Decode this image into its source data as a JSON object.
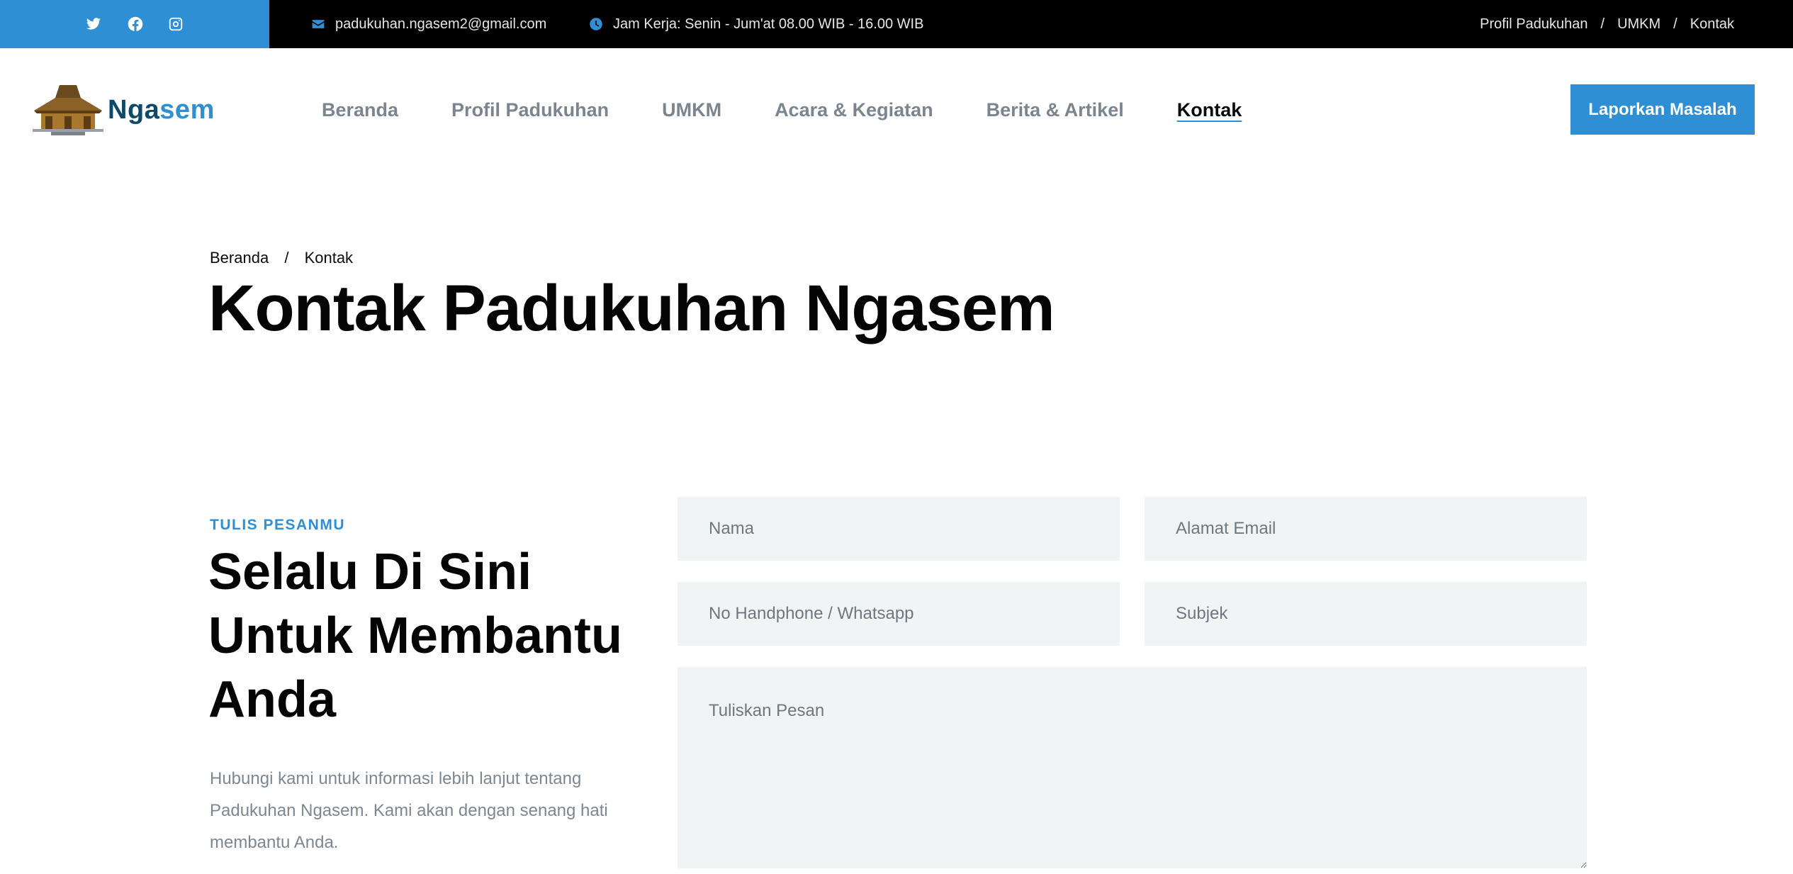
{
  "topbar": {
    "social": [
      {
        "icon": "twitter-icon"
      },
      {
        "icon": "facebook-icon"
      },
      {
        "icon": "instagram-icon"
      }
    ],
    "email": "padukuhan.ngasem2@gmail.com",
    "hours": "Jam Kerja: Senin - Jum'at 08.00 WIB - 16.00 WIB",
    "links": [
      "Profil Padukuhan",
      "UMKM",
      "Kontak"
    ],
    "separator": "/"
  },
  "header": {
    "logo_text_primary": "Nga",
    "logo_text_accent": "sem",
    "nav": [
      {
        "label": "Beranda",
        "active": false
      },
      {
        "label": "Profil Padukuhan",
        "active": false
      },
      {
        "label": "UMKM",
        "active": false
      },
      {
        "label": "Acara & Kegiatan",
        "active": false
      },
      {
        "label": "Berita & Artikel",
        "active": false
      },
      {
        "label": "Kontak",
        "active": true
      }
    ],
    "cta_label": "Laporkan Masalah"
  },
  "page": {
    "breadcrumb": [
      "Beranda",
      "Kontak"
    ],
    "breadcrumb_separator": "/",
    "title": "Kontak Padukuhan Ngasem"
  },
  "contact": {
    "eyebrow": "TULIS PESANMU",
    "heading": "Selalu Di Sini Untuk Membantu Anda",
    "description": "Hubungi kami untuk informasi lebih lanjut tentang Padukuhan Ngasem. Kami akan dengan senang hati membantu Anda.",
    "form": {
      "name_placeholder": "Nama",
      "email_placeholder": "Alamat Email",
      "phone_placeholder": "No Handphone / Whatsapp",
      "subject_placeholder": "Subjek",
      "message_placeholder": "Tuliskan Pesan"
    }
  },
  "colors": {
    "accent": "#2f8fd4",
    "topbar_bg": "#000000",
    "logo_dark": "#0e4a68",
    "field_bg": "#f1f4f4",
    "muted_text": "#7c8791"
  }
}
